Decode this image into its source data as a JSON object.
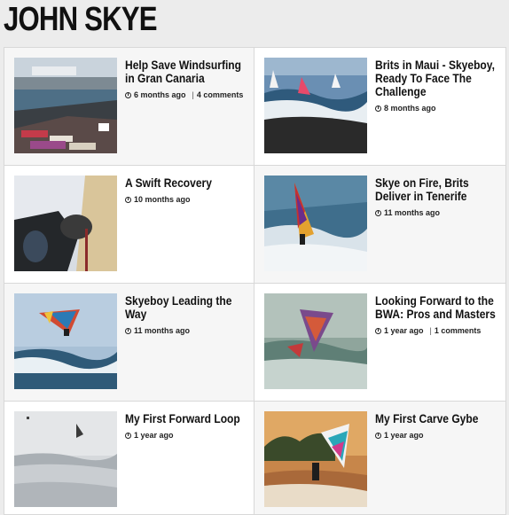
{
  "page": {
    "title": "JOHN SKYE"
  },
  "posts": [
    {
      "title": "Help Save Windsurfing in Gran Canaria",
      "age": "6 months ago",
      "comments": "4 comments"
    },
    {
      "title": "Brits in Maui - Skyeboy, Ready To Face The Challenge",
      "age": "8 months ago",
      "comments": ""
    },
    {
      "title": "A Swift Recovery",
      "age": "10 months ago",
      "comments": ""
    },
    {
      "title": "Skye on Fire, Brits Deliver in Tenerife",
      "age": "11 months ago",
      "comments": ""
    },
    {
      "title": "Skyeboy Leading the Way",
      "age": "11 months ago",
      "comments": ""
    },
    {
      "title": "Looking Forward to the BWA: Pros and Masters",
      "age": "1 year ago",
      "comments": "1 comments"
    },
    {
      "title": "My First Forward Loop",
      "age": "1 year ago",
      "comments": ""
    },
    {
      "title": "My First Carve Gybe",
      "age": "1 year ago",
      "comments": ""
    }
  ],
  "icons": {
    "meta": "clock-icon"
  }
}
